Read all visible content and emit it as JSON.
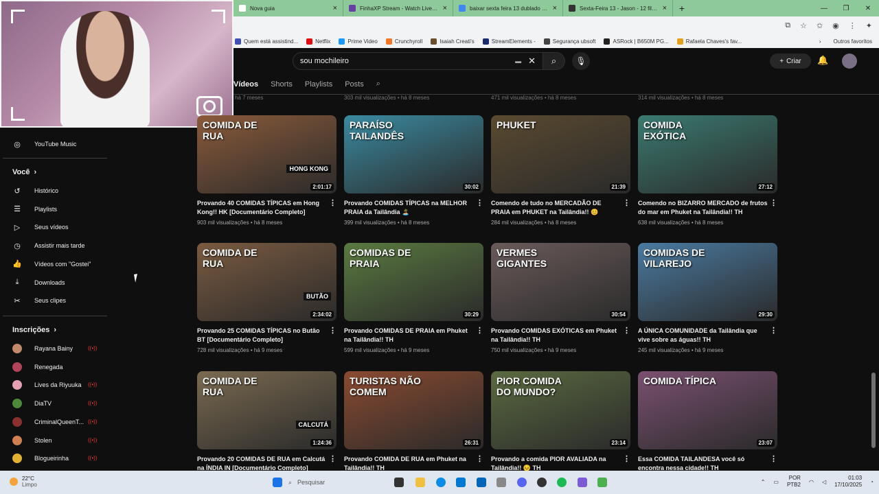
{
  "browser": {
    "tabs": [
      {
        "label": "Nova guia",
        "favicon_color": "#ffffff"
      },
      {
        "label": "FinhaXP Stream - Watch Live on T",
        "favicon_color": "#6441a5"
      },
      {
        "label": "baixar sexta feira 13 dublado torre",
        "favicon_color": "#4285f4"
      },
      {
        "label": "Sexta-Feira 13 - Jason - 12 filmes",
        "favicon_color": "#333333"
      }
    ],
    "new_tab": "+",
    "window_controls": [
      "—",
      "❐",
      "✕"
    ],
    "bookmarks": [
      {
        "label": "Quem está assistind...",
        "color": "#3f51b5"
      },
      {
        "label": "Netflix",
        "color": "#e50914"
      },
      {
        "label": "Prime Video",
        "color": "#1a98ff"
      },
      {
        "label": "Crunchyroll",
        "color": "#f47521"
      },
      {
        "label": "Isaiah Creati's",
        "color": "#6b4e2e"
      },
      {
        "label": "StreamElements -",
        "color": "#1b2a6b"
      },
      {
        "label": "Segurança ubsoft",
        "color": "#444444"
      },
      {
        "label": "ASRock | B650M PG...",
        "color": "#222222"
      },
      {
        "label": "Rafaela Chaves's fav...",
        "color": "#e4a11b"
      }
    ],
    "other_bookmarks": "Outros favoritos"
  },
  "header": {
    "search_value": "sou mochileiro",
    "create_label": "Criar"
  },
  "channel_tabs": [
    "Vídeos",
    "Shorts",
    "Playlists",
    "Posts"
  ],
  "sidebar": {
    "youtube_music": "YouTube Music",
    "voce": "Você",
    "items": [
      "Histórico",
      "Playlists",
      "Seus vídeos",
      "Assistir mais tarde",
      "Vídeos com \"Gostei\"",
      "Downloads",
      "Seus clipes"
    ],
    "inscricoes": "Inscrições",
    "subscriptions": [
      {
        "name": "Rayana Bainy",
        "live": true,
        "color": "#c08a6a"
      },
      {
        "name": "Renegada",
        "live": false,
        "color": "#b0455a"
      },
      {
        "name": "Lives da Riyuuka",
        "live": true,
        "color": "#e3a0b0"
      },
      {
        "name": "DiaTV",
        "live": true,
        "color": "#4a8a3a"
      },
      {
        "name": "CriminalQueenT...",
        "live": true,
        "color": "#8a3030"
      },
      {
        "name": "Stolen",
        "live": true,
        "color": "#d08050"
      },
      {
        "name": "Blogueirinha",
        "live": true,
        "color": "#e0b030"
      }
    ]
  },
  "top_meta": [
    "há 7 meses",
    "303 mil visualizações • há 8 meses",
    "471 mil visualizações • há 8 meses",
    "314 mil visualizações • há 8 meses"
  ],
  "videos": [
    {
      "title": "Provando 40 COMIDAS TÍPICAS em Hong Kong!! HK [Documentário Completo]",
      "meta": "903 mil visualizações • há 8 meses",
      "duration": "2:01:17",
      "tag": "COMIDA DE RUA",
      "tag2": "HONG KONG",
      "bg": "#8a5a3a"
    },
    {
      "title": "Provando COMIDAS TÍPICAS na MELHOR PRAIA da Tailândia 🏝️",
      "meta": "399 mil visualizações • há 8 meses",
      "duration": "30:02",
      "tag": "PARAÍSO TAILANDÊS",
      "tag2": "",
      "bg": "#3a8aa0"
    },
    {
      "title": "Comendo de tudo no MERCADÃO DE PRAIA em PHUKET na Tailândia!! 😊",
      "meta": "284 mil visualizações • há 8 meses",
      "duration": "21:39",
      "tag": "PHUKET",
      "tag2": "",
      "bg": "#5a4a30"
    },
    {
      "title": "Comendo no BIZARRO MERCADO de frutos do mar em Phuket na Tailândia!! TH",
      "meta": "638 mil visualizações • há 8 meses",
      "duration": "27:12",
      "tag": "COMIDA EXÓTICA",
      "tag2": "",
      "bg": "#3a7a70"
    },
    {
      "title": "Provando 25 COMIDAS TÍPICAS no Butão BT [Documentário Completo]",
      "meta": "728 mil visualizações • há 9 meses",
      "duration": "2:34:02",
      "tag": "COMIDA DE RUA",
      "tag2": "BUTÃO",
      "bg": "#7a5a40"
    },
    {
      "title": "Provando COMIDAS DE PRAIA em Phuket na Tailândia!! TH",
      "meta": "599 mil visualizações • há 9 meses",
      "duration": "30:29",
      "tag": "COMIDAS DE PRAIA",
      "tag2": "",
      "bg": "#5a7a40"
    },
    {
      "title": "Provando COMIDAS EXÓTICAS em Phuket na Tailândia!! TH",
      "meta": "750 mil visualizações • há 9 meses",
      "duration": "30:54",
      "tag": "VERMES GIGANTES",
      "tag2": "",
      "bg": "#6a5a5a"
    },
    {
      "title": "A ÚNICA COMUNIDADE da Tailândia que vive sobre as águas!! TH",
      "meta": "245 mil visualizações • há 9 meses",
      "duration": "29:30",
      "tag": "COMIDAS DE VILAREJO",
      "tag2": "",
      "bg": "#4a7aa0"
    },
    {
      "title": "Provando 20 COMIDAS DE RUA em Calcutá na ÍNDIA IN [Documentário Completo]",
      "meta": "",
      "duration": "1:24:36",
      "tag": "COMIDA DE RUA",
      "tag2": "CALCUTÁ",
      "bg": "#7a6a50"
    },
    {
      "title": "Provando COMIDA DE RUA em Phuket na Tailândia!! TH",
      "meta": "",
      "duration": "26:31",
      "tag": "TURISTAS NÃO COMEM",
      "tag2": "",
      "bg": "#8a4a30"
    },
    {
      "title": "Provando a comida PIOR AVALIADA na Tailândia!! 😣 TH",
      "meta": "",
      "duration": "23:14",
      "tag": "PIOR COMIDA DO MUNDO?",
      "tag2": "",
      "bg": "#5a6a40"
    },
    {
      "title": "Essa COMIDA TAILANDESA você só encontra nessa cidade!! TH",
      "meta": "",
      "duration": "23:07",
      "tag": "COMIDA TÍPICA",
      "tag2": "",
      "bg": "#7a5070"
    }
  ],
  "taskbar": {
    "temp": "22°C",
    "weather": "Limpo",
    "search": "Pesquisar",
    "lang1": "POR",
    "lang2": "PTB2",
    "time": "01:03",
    "date": "17/10/2025"
  }
}
